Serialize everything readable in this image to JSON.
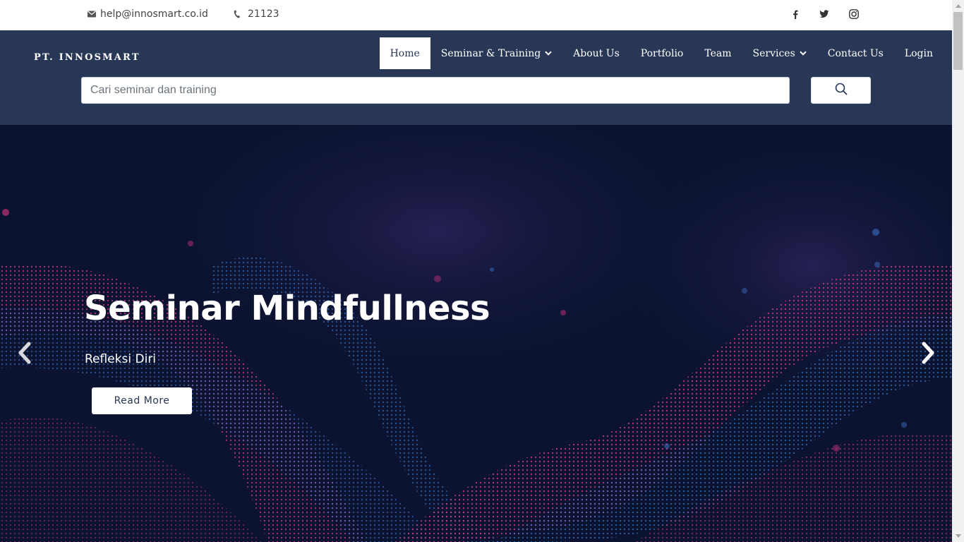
{
  "topbar": {
    "email": "help@innosmart.co.id",
    "phone": "21123",
    "icons": {
      "email": "envelope-icon",
      "phone": "phone-icon",
      "facebook": "facebook-icon",
      "twitter": "twitter-icon",
      "instagram": "instagram-icon"
    }
  },
  "header": {
    "brand": "PT. INNOSMART",
    "nav": [
      {
        "label": "Home",
        "active": true
      },
      {
        "label": "Seminar & Training",
        "dropdown": true
      },
      {
        "label": "About Us"
      },
      {
        "label": "Portfolio"
      },
      {
        "label": "Team"
      },
      {
        "label": "Services",
        "dropdown": true
      },
      {
        "label": "Contact Us"
      },
      {
        "label": "Login"
      }
    ],
    "search": {
      "placeholder": "Cari seminar dan training",
      "value": "",
      "button_icon": "search-icon"
    }
  },
  "hero": {
    "title": "Seminar Mindfullness",
    "subtitle": "Refleksi Diri",
    "button": "Read More",
    "prev_icon": "chevron-left-icon",
    "next_icon": "chevron-right-icon"
  },
  "colors": {
    "header_bg": "#283755",
    "hero_bg": "#0b1330",
    "wave_pink": "#c2327a",
    "wave_blue": "#3a6fc4"
  }
}
